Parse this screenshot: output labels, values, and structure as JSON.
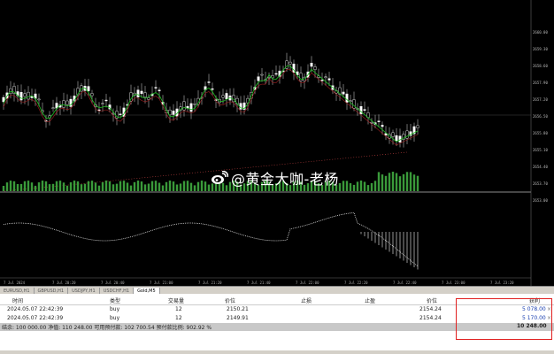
{
  "price_axis": [
    "2660.00",
    "2659.30",
    "2658.60",
    "2657.90",
    "2657.20",
    "2656.50",
    "2655.80",
    "2655.10",
    "2654.40",
    "2653.70",
    "2653.00"
  ],
  "time_axis": [
    "7 Jul 2024",
    "7 Jul 20:20",
    "7 Jul 20:40",
    "7 Jul 21:00",
    "7 Jul 21:20",
    "7 Jul 21:40",
    "7 Jul 22:00",
    "7 Jul 22:20",
    "7 Jul 22:40",
    "7 Jul 23:00",
    "7 Jul 23:20"
  ],
  "watermark": {
    "handle": "@黄金大咖-老杨",
    "icon": "weibo-icon"
  },
  "tabs": [
    {
      "label": "EURUSD,H1",
      "active": false
    },
    {
      "label": "GBPUSD,H1",
      "active": false
    },
    {
      "label": "USDJPY,H1",
      "active": false
    },
    {
      "label": "USDCHF,H1",
      "active": false
    },
    {
      "label": "Gold,M5",
      "active": true
    }
  ],
  "trade_table": {
    "headers": {
      "time": "时间",
      "type": "类型",
      "volume": "交易量",
      "price": "价位",
      "sl": "止损",
      "tp": "止盈",
      "price2": "价位",
      "profit": "获利"
    },
    "rows": [
      {
        "time": "2024.05.07 22:42:39",
        "type": "buy",
        "volume": "12",
        "price": "2150.21",
        "price2": "2154.24",
        "profit": "5 078.00"
      },
      {
        "time": "2024.05.07 22:42:39",
        "type": "buy",
        "volume": "12",
        "price": "2149.91",
        "price2": "2154.24",
        "profit": "5 170.00"
      }
    ],
    "summary": {
      "label": "结余: 100 000.00  净值: 110 248.00  可用预付款: 102 700.54  预付款比例: 902.92 %",
      "total": "10 248.00"
    }
  },
  "colors": {
    "background": "#000000",
    "bull_candle": "#ffffff",
    "bear_candle": "#ffffff",
    "ma_line": "#20c020",
    "volume_bar": "#3a9a3a",
    "highlight": "#e02020"
  }
}
